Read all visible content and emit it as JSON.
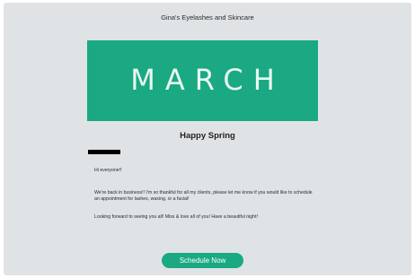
{
  "email": {
    "brand_name": "Gina's Eyelashes and Skincare",
    "hero": {
      "text": "MARCH",
      "color": "#1aa982"
    },
    "headline": "Happy Spring",
    "paragraphs": [
      "Hi everyone!!",
      "We're back in business!! I'm so thankful for all my clients, please let me know if you would like to schedule an appointment for lashes, waxing, or a facial!",
      "Looking forward to seeing you all! Miss & love all of you! Have a beautiful night!"
    ],
    "cta_label": "Schedule Now",
    "background_color": "#dfe3e6"
  }
}
